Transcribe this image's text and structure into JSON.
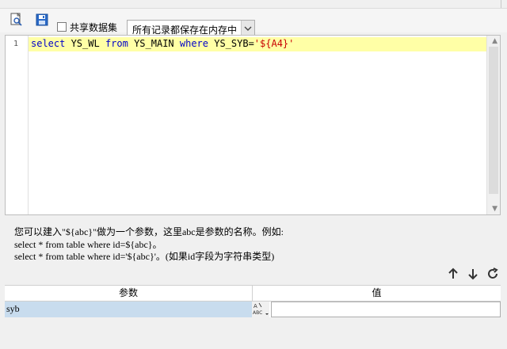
{
  "toolbar": {
    "preview_icon": "preview-icon",
    "save_icon": "save-icon",
    "shared_dataset_label": "共享数据集",
    "shared_dataset_checked": false,
    "storage_mode": "所有记录都保存在内存中"
  },
  "editor": {
    "line_number": "1",
    "sql": {
      "kw_select": "select",
      "field": " YS_WL ",
      "kw_from": "from",
      "table": " YS_MAIN ",
      "kw_where": "where",
      "condition": " YS_SYB=",
      "param_string": "'${A4}'"
    }
  },
  "help": {
    "line1": "您可以建入\"${abc}\"做为一个参数，这里abc是参数的名称。例如:",
    "line2": "select * from table where id=${abc}。",
    "line3": "select * from table where id='${abc}'。(如果id字段为字符串类型)"
  },
  "actions": {
    "move_up_icon": "arrow-up-icon",
    "move_down_icon": "arrow-down-icon",
    "refresh_icon": "refresh-icon"
  },
  "params": {
    "col_name": "参数",
    "col_value": "值",
    "rows": [
      {
        "name": "syb",
        "value": ""
      }
    ]
  },
  "colors": {
    "keyword": "#0000c8",
    "string": "#c80000",
    "highlight_line": "#ffffa6",
    "selected_row": "#c8dcee"
  }
}
